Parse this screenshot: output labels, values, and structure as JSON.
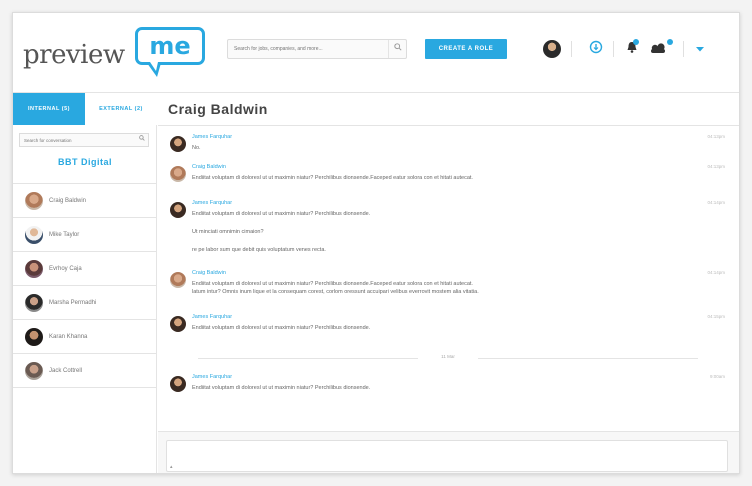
{
  "brand": {
    "logo_text_preview": "preview",
    "logo_text_me": "me",
    "accent_color": "#29a8e0"
  },
  "header": {
    "search_placeholder": "Search for jobs, companies, and more...",
    "search_icon": "search-icon",
    "create_button_label": "CREATE A ROLE",
    "icons": [
      "user-avatar",
      "download-icon",
      "notification-icon",
      "messages-icon",
      "chevron-down-icon"
    ]
  },
  "sidebar": {
    "tabs": [
      {
        "label": "INTERNAL (5)",
        "active": true
      },
      {
        "label": "EXTERNAL (2)",
        "active": false
      }
    ],
    "search_placeholder": "Search for conversation",
    "company": "BBT Digital",
    "contacts": [
      {
        "name": "Craig Baldwin"
      },
      {
        "name": "Mike Taylor"
      },
      {
        "name": "Evrhoy Caja"
      },
      {
        "name": "Marsha Permadhi"
      },
      {
        "name": "Karan Khanna"
      },
      {
        "name": "Jack Cottrell"
      }
    ]
  },
  "conversation": {
    "title": "Craig Baldwin",
    "date_separator": "11 Mar",
    "messages": [
      {
        "sender": "James Farquhar",
        "time": "04:13pm",
        "lines": [
          "No."
        ]
      },
      {
        "sender": "Craig Baldwin",
        "time": "04:13pm",
        "lines": [
          "Endiitat voluptam di doloresl ut ut maximin niatur? Perchilibus dionsende.Faceped eatur solora con et hitati autecat."
        ]
      },
      {
        "sender": "James Farquhar",
        "time": "04:14pm",
        "lines": [
          "Endiitat voluptam di doloresl ut ut maximin niatur? Perchilibus dionsende.",
          "Ut minciati omnimin cimaion?",
          "re pe labor sum que debit quis voluptatum venes recta."
        ]
      },
      {
        "sender": "Craig Baldwin",
        "time": "04:14pm",
        "lines": [
          "Endiitat voluptam di doloresl ut ut maximin niatur? Perchilibus dionsende.Faceped eatur solora con et hitati autecat.",
          "latum intur? Omnis inum lique et la consequam corest, corlom oressunt accuipari velibus everrovit mostem alia vitatia."
        ]
      },
      {
        "sender": "James Farquhar",
        "time": "04:15pm",
        "lines": [
          "Endiitat voluptam di doloresl ut ut maximin niatur? Perchilibus dionsende."
        ]
      },
      {
        "sender": "James Farquhar",
        "time": "9:00am",
        "lines": [
          "Endiitat voluptam di doloresl ut ut maximin niatur? Perchilibus dionsende."
        ]
      }
    ],
    "composer_placeholder": ""
  }
}
